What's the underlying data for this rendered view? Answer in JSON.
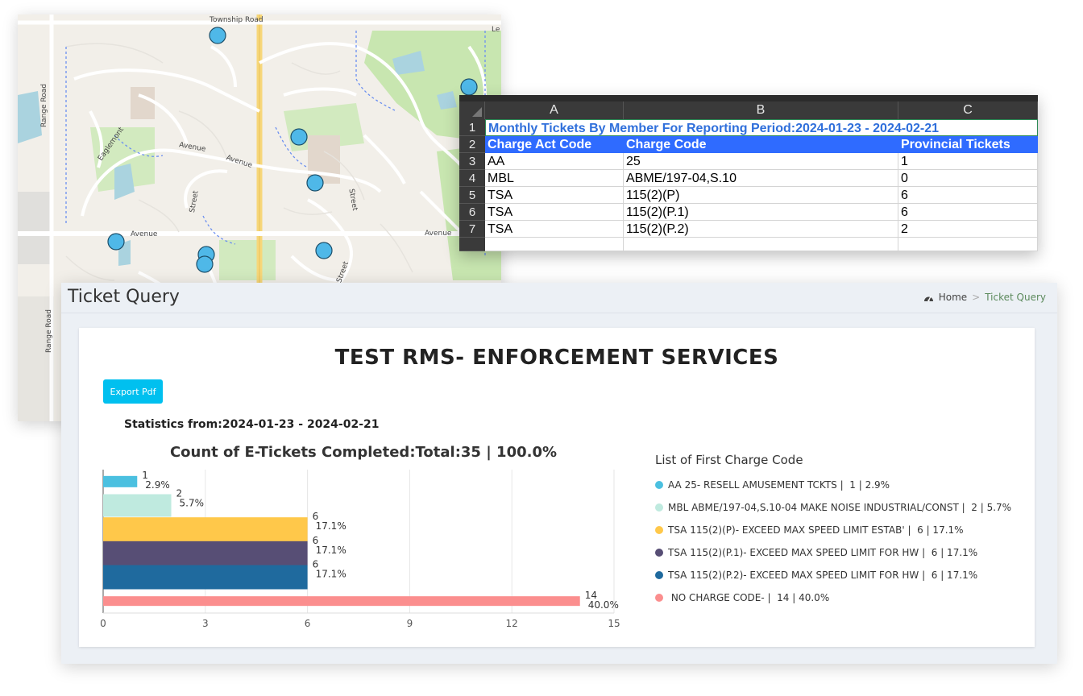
{
  "map": {
    "labels": {
      "township_road": "Township Road",
      "range_road_1": "Range Road",
      "range_road_2": "Range Road",
      "eaglemont": "Eaglemont",
      "avenue_1": "Avenue",
      "avenue_2": "Avenue",
      "avenue_3": "Avenue",
      "avenue_4": "Avenue",
      "street_1": "Street",
      "street_2": "Street",
      "street_3": "Street",
      "corner_text": "Le"
    },
    "marker_color": "#4fb8e8"
  },
  "spreadsheet": {
    "columns": [
      "A",
      "B",
      "C"
    ],
    "row_numbers": [
      "1",
      "2",
      "3",
      "4",
      "5",
      "6",
      "7"
    ],
    "title": "Monthly Tickets By Member For Reporting Period:2024-01-23 - 2024-02-21",
    "headers": [
      "Charge Act Code",
      "Charge Code",
      "Provincial Tickets"
    ],
    "rows": [
      [
        "AA",
        "25",
        "1"
      ],
      [
        "MBL",
        "ABME/197-04,S.10",
        "0"
      ],
      [
        "TSA",
        "115(2)(P)",
        "6"
      ],
      [
        "TSA",
        "115(2)(P.1)",
        "6"
      ],
      [
        "TSA",
        "115(2)(P.2)",
        "2"
      ]
    ],
    "title_color": "#2f6fdb",
    "header_bg": "#2f6bff"
  },
  "panel": {
    "page_title": "Ticket Query",
    "breadcrumb": {
      "home": "Home",
      "separator": ">",
      "current": "Ticket Query"
    },
    "org_title": "TEST RMS- ENFORCEMENT SERVICES",
    "export_label": "Export Pdf",
    "stats_text": "Statistics from:2024-01-23 - 2024-02-21",
    "chart_title": "Count of E-Tickets Completed:Total:35  |  100.0%",
    "legend_title": "List of First Charge Code"
  },
  "chart_data": {
    "type": "bar",
    "orientation": "horizontal",
    "title": "Count of E-Tickets Completed:Total:35  |  100.0%",
    "categories": [
      "AA 25- RESELL AMUSEMENT TCKTS |  1 | 2.9%",
      "MBL ABME/197-04,S.10-04 MAKE NOISE INDUSTRIAL/CONST |  2 | 5.7%",
      "TSA 115(2)(P)- EXCEED MAX SPEED LIMIT ESTAB' |  6 | 17.1%",
      "TSA 115(2)(P.1)- EXCEED MAX SPEED LIMIT FOR HW |  6 | 17.1%",
      "TSA 115(2)(P.2)- EXCEED MAX SPEED LIMIT FOR HW |  6 | 17.1%",
      " NO CHARGE CODE- |  14 | 40.0%"
    ],
    "values": [
      1,
      2,
      6,
      6,
      6,
      14
    ],
    "value_labels": [
      "1",
      "2",
      "6",
      "6",
      "6",
      "14"
    ],
    "percent_labels": [
      "2.9%",
      "5.7%",
      "17.1%",
      "17.1%",
      "17.1%",
      "40.0%"
    ],
    "colors": [
      "#4bc0e0",
      "#bfeadf",
      "#ffc84a",
      "#574e75",
      "#1f6a9e",
      "#fb8e8e"
    ],
    "xlim": [
      0,
      15
    ],
    "xticks": [
      "0",
      "3",
      "6",
      "9",
      "12",
      "15"
    ],
    "xtick_values": [
      0,
      3,
      6,
      9,
      12,
      15
    ],
    "grid": true,
    "legend_placement": "right"
  }
}
